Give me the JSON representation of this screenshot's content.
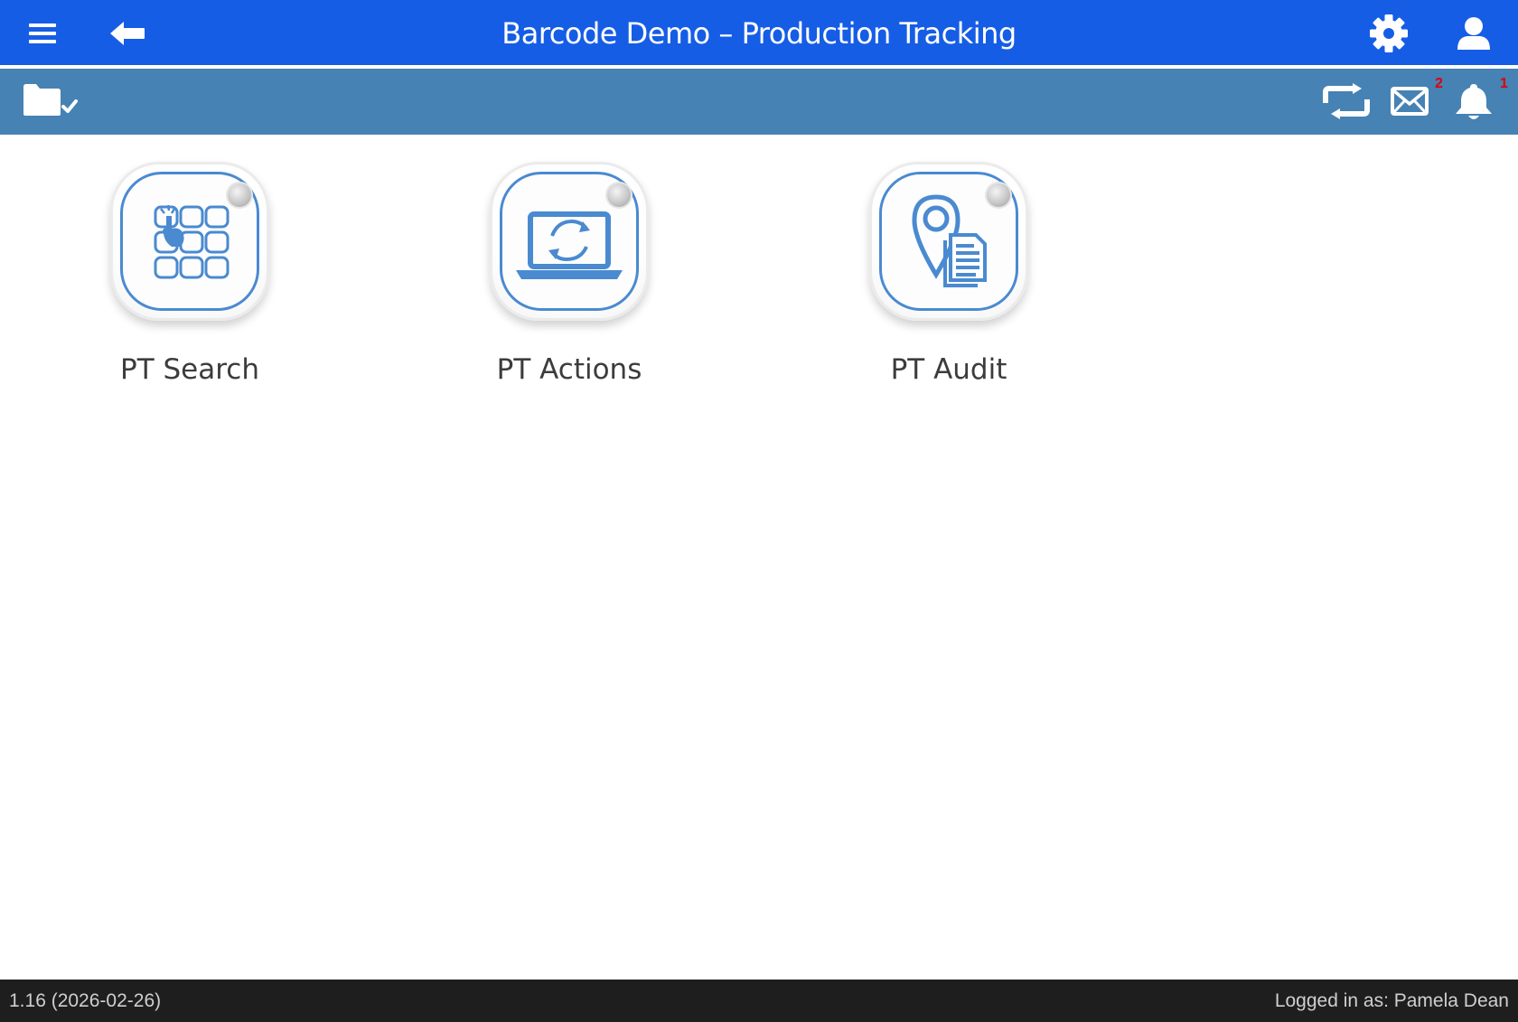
{
  "app": {
    "title": "Barcode Demo – Production Tracking"
  },
  "topbar": {
    "menu_icon": "hamburger-menu-icon",
    "back_icon": "arrow-left-icon",
    "settings_icon": "gear-icon",
    "user_icon": "user-icon"
  },
  "subbar": {
    "folder_icon": "folder-check-icon",
    "sync_icon": "sync-arrows-icon",
    "mail": {
      "icon": "envelope-icon",
      "count": "2"
    },
    "notifications": {
      "icon": "bell-icon",
      "count": "1"
    }
  },
  "tiles": [
    {
      "label": "PT Search",
      "icon": "keypad-touch-icon"
    },
    {
      "label": "PT Actions",
      "icon": "laptop-sync-icon"
    },
    {
      "label": "PT Audit",
      "icon": "map-pin-document-icon"
    }
  ],
  "footer": {
    "version": "1.16 (2026-02-26)",
    "logged_in": "Logged in as: Pamela Dean"
  },
  "colors": {
    "header_bg": "#165de6",
    "subbar_bg": "#4682b4",
    "icon_blue": "#4a8ad0",
    "badge_red": "#e00000",
    "footer_bg": "#1e1e1e"
  }
}
